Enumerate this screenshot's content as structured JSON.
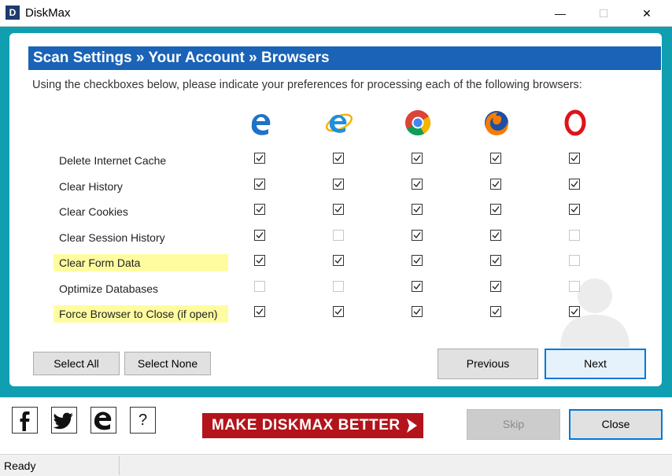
{
  "window": {
    "title": "DiskMax",
    "logo_text": "D",
    "minimize": "—",
    "maximize": "☐",
    "close": "✕"
  },
  "header": {
    "breadcrumb": "Scan Settings  »  Your Account  »  Browsers"
  },
  "instructions": "Using the checkboxes below, please indicate your preferences for processing each of the following browsers:",
  "browsers": [
    "edge-icon",
    "internet-explorer-icon",
    "chrome-icon",
    "firefox-icon",
    "opera-icon"
  ],
  "rows": [
    {
      "label": "Delete Internet Cache",
      "highlight": false,
      "checks": [
        true,
        true,
        true,
        true,
        true
      ]
    },
    {
      "label": "Clear History",
      "highlight": false,
      "checks": [
        true,
        true,
        true,
        true,
        true
      ]
    },
    {
      "label": "Clear Cookies",
      "highlight": false,
      "checks": [
        true,
        true,
        true,
        true,
        true
      ]
    },
    {
      "label": "Clear Session History",
      "highlight": false,
      "checks": [
        true,
        false,
        true,
        true,
        false
      ]
    },
    {
      "label": "Clear Form Data",
      "highlight": true,
      "checks": [
        true,
        true,
        true,
        true,
        false
      ]
    },
    {
      "label": "Optimize Databases",
      "highlight": false,
      "checks": [
        false,
        false,
        true,
        true,
        false
      ]
    },
    {
      "label": "Force Browser to Close (if open)",
      "highlight": true,
      "checks": [
        true,
        true,
        true,
        true,
        true
      ]
    }
  ],
  "buttons": {
    "select_all": "Select All",
    "select_none": "Select None",
    "previous": "Previous",
    "next": "Next"
  },
  "footer": {
    "social": [
      "facebook-icon",
      "twitter-icon",
      "web-icon",
      "help-icon"
    ],
    "help_glyph": "?",
    "promo": "MAKE DISKMAX BETTER",
    "skip": "Skip",
    "close": "Close"
  },
  "status": {
    "text": "Ready"
  },
  "colors": {
    "accent": "#1a63b6",
    "frame": "#0f9fb1",
    "promo": "#b3141b",
    "highlight": "#fffca0"
  }
}
